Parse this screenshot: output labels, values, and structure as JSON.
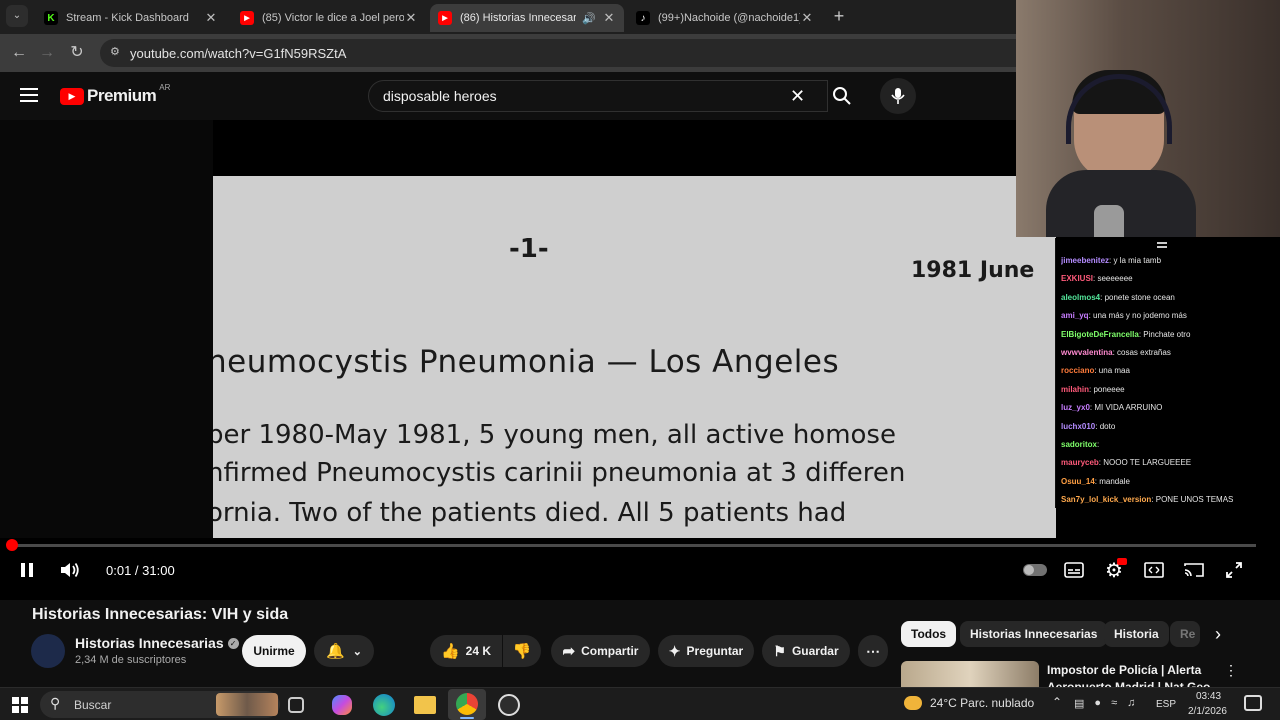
{
  "browser": {
    "tabs": [
      {
        "title": "Stream - Kick Dashboard",
        "favicon": "kick-icon",
        "active": false
      },
      {
        "title": "(85) Victor le dice a Joel pero co",
        "favicon": "youtube-icon",
        "active": false
      },
      {
        "title": "(86) Historias Innecesarias: V",
        "favicon": "youtube-icon",
        "active": true
      },
      {
        "title": "(99+)Nachoide (@nachoide1) |",
        "favicon": "tiktok-icon",
        "active": false
      }
    ],
    "url": "youtube.com/watch?v=G1fN59RSZtA"
  },
  "youtube": {
    "logo_text": "Premium",
    "region": "AR",
    "search_value": "disposable heroes"
  },
  "document": {
    "page_number": "-1-",
    "date": "1981 June",
    "heading": "neumocystis  Pneumonia — Los Angeles",
    "line1": "ber 1980-May 1981, 5 young men, all active homose",
    "line2": "nfirmed Pneumocystis carinii pneumonia at 3 differen",
    "line3": "ornia. Two of the patients died. All 5 patients had"
  },
  "player": {
    "time": "0:01 / 31:00",
    "progress_fraction": 0.0005
  },
  "chat": [
    {
      "user": "jimeebenitez",
      "text": "y la mia tamb",
      "color": "#b48cff"
    },
    {
      "user": "EXKIUSI",
      "text": "seeeeeee",
      "color": "#ff5a7a"
    },
    {
      "user": "aleolmos4",
      "text": "ponete stone ocean",
      "color": "#53e69a"
    },
    {
      "user": "ami_yq",
      "text": "una más y no jodemo más",
      "color": "#c77dff"
    },
    {
      "user": "ElBigoteDeFrancella",
      "text": "Pinchate otro",
      "color": "#7fff6b"
    },
    {
      "user": "wvwvalentina",
      "text": "cosas extrañas",
      "color": "#ff8ad0"
    },
    {
      "user": "rocciano",
      "text": "una maa",
      "color": "#ff7b3a"
    },
    {
      "user": "milahin",
      "text": "poneeee",
      "color": "#ff5a7a"
    },
    {
      "user": "luz_yx0",
      "text": "MI VIDA ARRUINO",
      "color": "#c77dff"
    },
    {
      "user": "luchx010",
      "text": "doto",
      "color": "#b48cff"
    },
    {
      "user": "sadoritox",
      "text": "",
      "color": "#7fff6b"
    },
    {
      "user": "mauryceb",
      "text": "NOOO TE LARGUEEEE",
      "color": "#ff5a7a"
    },
    {
      "user": "Osuu_14",
      "text": "mandale",
      "color": "#ff9f43"
    },
    {
      "user": "San7y_lol_kick_version",
      "text": "PONE UNOS TEMAS",
      "color": "#ffa94d"
    }
  ],
  "video_info": {
    "title": "Historias Innecesarias: VIH y sida",
    "channel": "Historias Innecesarias",
    "subscribers": "2,34 M de suscriptores",
    "join_label": "Unirme",
    "likes": "24 K",
    "share_label": "Compartir",
    "ask_label": "Preguntar",
    "save_label": "Guardar"
  },
  "chips": [
    "Todos",
    "Historias Innecesarias",
    "Historia",
    "Re"
  ],
  "recommendation": {
    "title_line1": "Impostor de Policía | Alerta",
    "title_line2": "Aeropuerto Madrid | Nat Geo e"
  },
  "taskbar": {
    "search_placeholder": "Buscar",
    "weather": "24°C  Parc. nublado",
    "lang": "ESP",
    "time": "03:43",
    "date": "2/1/2026"
  },
  "colors": {
    "youtube_red": "#ff0000",
    "kick_green": "#53fc18"
  }
}
